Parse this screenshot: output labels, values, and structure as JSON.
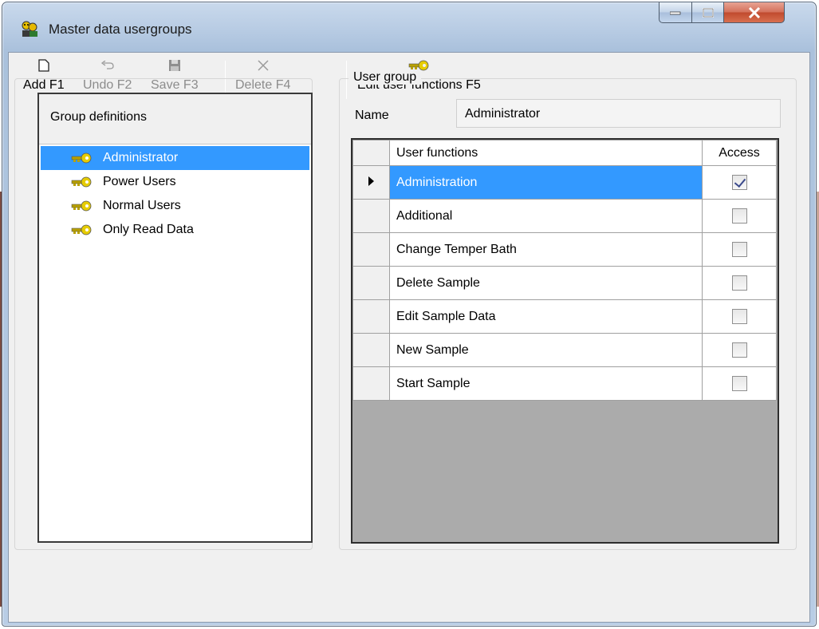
{
  "window": {
    "title": "Master data usergroups"
  },
  "toolbar": {
    "add_label": "Add F1",
    "undo_label": "Undo F2",
    "save_label": "Save F3",
    "delete_label": "Delete F4",
    "edit_functions_label": "Edit user functions F5"
  },
  "groups": {
    "header": "Group definitions",
    "items": [
      {
        "label": "Administrator",
        "selected": true
      },
      {
        "label": "Power Users",
        "selected": false
      },
      {
        "label": "Normal Users",
        "selected": false
      },
      {
        "label": "Only Read Data",
        "selected": false
      }
    ]
  },
  "user_group": {
    "title": "User group",
    "name_label": "Name",
    "name_value": "Administrator"
  },
  "functions_grid": {
    "col_function": "User functions",
    "col_access": "Access",
    "rows": [
      {
        "function": "Administration",
        "access": true
      },
      {
        "function": "Additional",
        "access": false
      },
      {
        "function": "Change Temper Bath",
        "access": false
      },
      {
        "function": "Delete Sample",
        "access": false
      },
      {
        "function": "Edit Sample Data",
        "access": false
      },
      {
        "function": "New Sample",
        "access": false
      },
      {
        "function": "Start Sample",
        "access": false
      }
    ]
  },
  "icons": {
    "app": "users-icon",
    "add": "new-document-icon",
    "undo": "undo-icon",
    "save": "floppy-disk-icon",
    "delete": "close-x-icon",
    "edit_functions": "key-icon",
    "group_item": "key-icon"
  },
  "colors": {
    "selection": "#3399ff",
    "close_button": "#c8553a"
  }
}
